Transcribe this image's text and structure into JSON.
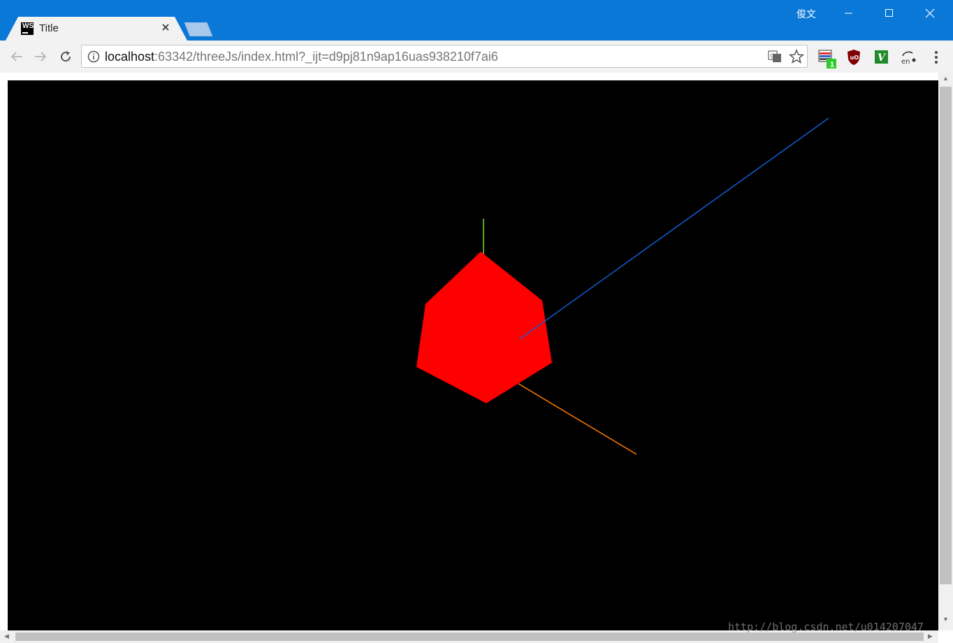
{
  "tab": {
    "title": "Title",
    "favicon_text": "WS"
  },
  "window": {
    "user_name": "俊文"
  },
  "address_bar": {
    "url_host": "localhost",
    "url_rest": ":63342/threeJs/index.html?_ijt=d9pj81n9ap16uas938210f7ai6"
  },
  "extensions": {
    "badge_count": "1",
    "ext_3_label": "V",
    "ext_4_label": "en"
  },
  "scene": {
    "background": "#000000",
    "cube_color": "#ff0000",
    "axes": {
      "x_color": "#ff8000",
      "y_color": "#4caf1a",
      "z_color": "#1060d0"
    }
  },
  "watermark": "http://blog.csdn.net/u014207047"
}
